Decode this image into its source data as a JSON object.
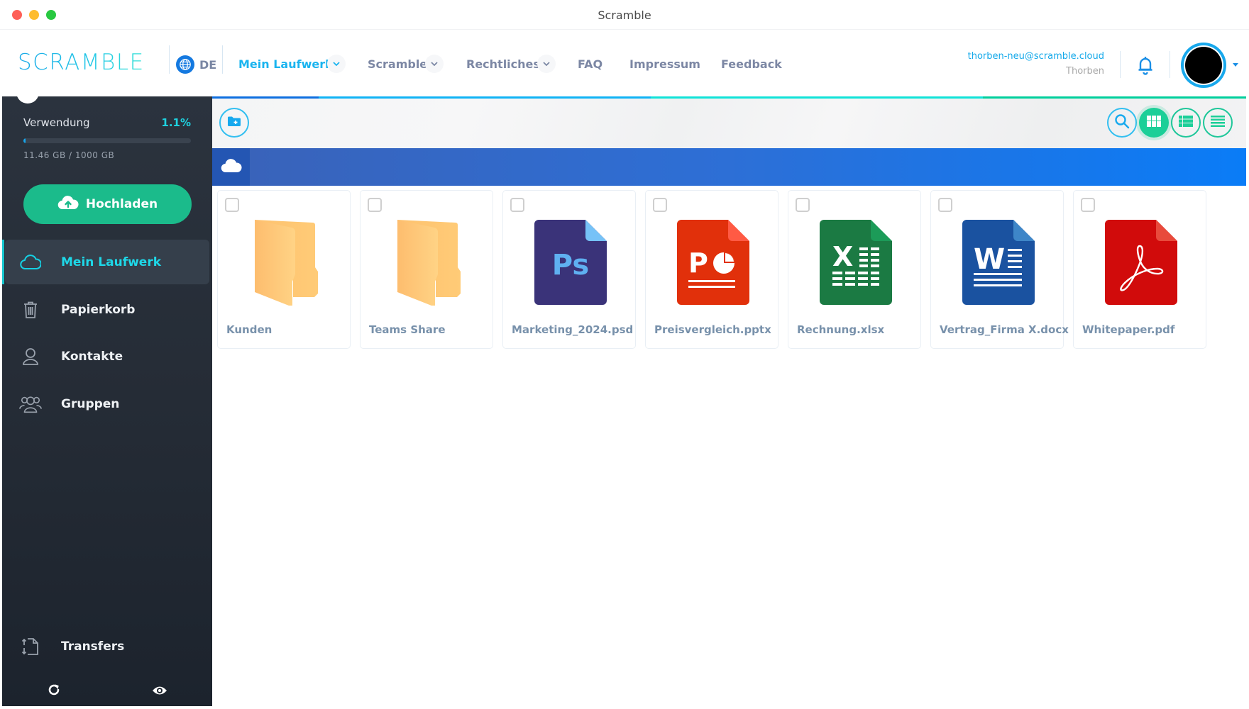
{
  "window": {
    "title": "Scramble"
  },
  "header": {
    "logo": "SCRAMBLE",
    "language": "DE",
    "nav": [
      {
        "label": "Mein Laufwerk",
        "has_dropdown": true,
        "active": true
      },
      {
        "label": "Scramble",
        "has_dropdown": true,
        "active": false
      },
      {
        "label": "Rechtliches",
        "has_dropdown": true,
        "active": false
      },
      {
        "label": "FAQ",
        "has_dropdown": false,
        "active": false
      },
      {
        "label": "Impressum",
        "has_dropdown": false,
        "active": false
      },
      {
        "label": "Feedback",
        "has_dropdown": false,
        "active": false
      }
    ],
    "user": {
      "email": "thorben-neu@scramble.cloud",
      "name": "Thorben"
    },
    "icons": {
      "language": "globe-icon",
      "notifications": "bell-icon",
      "avatar_menu": "caret-down-icon"
    }
  },
  "sidebar": {
    "usage": {
      "label": "Verwendung",
      "percent_label": "1.1%",
      "percent": 1.1,
      "used_text": "11.46 GB / 1000 GB"
    },
    "upload_button": {
      "label": "Hochladen",
      "icon": "cloud-upload-icon"
    },
    "items": [
      {
        "label": "Mein Laufwerk",
        "icon": "cloud-icon",
        "active": true
      },
      {
        "label": "Papierkorb",
        "icon": "trash-icon",
        "active": false
      },
      {
        "label": "Kontakte",
        "icon": "user-icon",
        "active": false
      },
      {
        "label": "Gruppen",
        "icon": "users-icon",
        "active": false
      }
    ],
    "bottom_item": {
      "label": "Transfers",
      "icon": "transfers-icon"
    },
    "footer_icons": [
      "refresh-icon",
      "eye-icon"
    ]
  },
  "toolbar": {
    "new_folder_icon": "folder-plus-icon",
    "search_icon": "search-icon",
    "view_modes": [
      {
        "name": "grid",
        "icon": "grid-icon",
        "active": true
      },
      {
        "name": "list",
        "icon": "list-detail-icon",
        "active": false
      },
      {
        "name": "compact",
        "icon": "list-icon",
        "active": false
      }
    ]
  },
  "breadcrumb": {
    "root_icon": "cloud-icon"
  },
  "colors": {
    "accent_blue": "#1ab4ef",
    "accent_green": "#1bbb8b",
    "sidebar_bg": "#252c36",
    "path_bar": "#0a7cf7",
    "topline": [
      "#0e6fe0",
      "#10b3f5",
      "#10e3d8",
      "#00cf9c"
    ]
  },
  "files": [
    {
      "name": "Kunden",
      "type": "folder"
    },
    {
      "name": "Teams Share",
      "type": "folder"
    },
    {
      "name": "Marketing_2024.psd",
      "type": "psd"
    },
    {
      "name": "Preisvergleich.pptx",
      "type": "pptx"
    },
    {
      "name": "Rechnung.xlsx",
      "type": "xlsx"
    },
    {
      "name": "Vertrag_Firma X.docx",
      "type": "docx"
    },
    {
      "name": "Whitepaper.pdf",
      "type": "pdf"
    }
  ]
}
